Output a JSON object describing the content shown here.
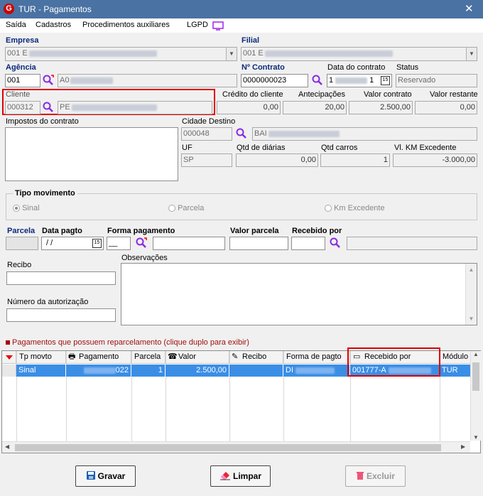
{
  "window": {
    "title": "TUR - Pagamentos",
    "close_glyph": "✕"
  },
  "menu": [
    "Saída",
    "Cadastros",
    "Procedimentos auxiliares",
    "LGPD"
  ],
  "empresa": {
    "label": "Empresa",
    "value": "001 E"
  },
  "filial": {
    "label": "Filial",
    "value": "001 E"
  },
  "agencia": {
    "label": "Agência",
    "code": "001",
    "name": "A0"
  },
  "contrato": {
    "label": "Nº Contrato",
    "value": "0000000023"
  },
  "data_contrato": {
    "label": "Data do contrato",
    "value": "1",
    "suffix": "1"
  },
  "status": {
    "label": "Status",
    "value": "Reservado"
  },
  "cliente": {
    "label": "Cliente",
    "code": "000312",
    "name": "PE"
  },
  "credito": {
    "label": "Crédito do cliente",
    "value": "0,00"
  },
  "antecipacoes": {
    "label": "Antecipações",
    "value": "20,00"
  },
  "valor_contrato": {
    "label": "Valor contrato",
    "value": "2.500,00"
  },
  "valor_restante": {
    "label": "Valor restante",
    "value": "0,00"
  },
  "impostos": {
    "label": "Impostos do contrato"
  },
  "cidade_destino": {
    "label": "Cidade Destino",
    "code": "000048",
    "name": "BAI"
  },
  "uf": {
    "label": "UF",
    "value": "SP"
  },
  "qtd_diarias": {
    "label": "Qtd de diárias",
    "value": "0,00"
  },
  "qtd_carros": {
    "label": "Qtd carros",
    "value": "1"
  },
  "vl_km": {
    "label": "Vl. KM Excedente",
    "value": "-3.000,00"
  },
  "tipo_movimento": {
    "label": "Tipo movimento",
    "options": [
      "Sinal",
      "Parcela",
      "Km Excedente"
    ]
  },
  "parcela": {
    "label": "Parcela"
  },
  "data_pagto": {
    "label": "Data pagto",
    "value": " /  /"
  },
  "forma_pagamento": {
    "label": "Forma pagamento",
    "value": "__"
  },
  "valor_parcela": {
    "label": "Valor parcela"
  },
  "recebido_por": {
    "label": "Recebido por"
  },
  "recibo": {
    "label": "Recibo"
  },
  "observacoes": {
    "label": "Observações"
  },
  "numero_autorizacao": {
    "label": "Número da autorização"
  },
  "reparcelamento_note": "Pagamentos que possuem reparcelamento (clique duplo para exibir)",
  "table": {
    "columns": [
      "Tp movto",
      "Pagamento",
      "Parcela",
      "Valor",
      "Recibo",
      "Forma de pagto",
      "Recebido por",
      "Módulo p"
    ],
    "rows": [
      {
        "tp": "Sinal",
        "pagamento": "022",
        "parcela": "1",
        "valor": "2.500,00",
        "recibo": "",
        "forma": "DI",
        "recebido": "001777-A",
        "modulo": "TUR"
      }
    ]
  },
  "buttons": {
    "gravar": "Gravar",
    "limpar": "Limpar",
    "excluir": "Excluir"
  },
  "colors": {
    "titlebar": "#4a72a3",
    "highlight": "#e00000",
    "selection": "#3a8ee6",
    "label_blue": "#0b2a7a",
    "magnifier": "#8a2be2"
  }
}
